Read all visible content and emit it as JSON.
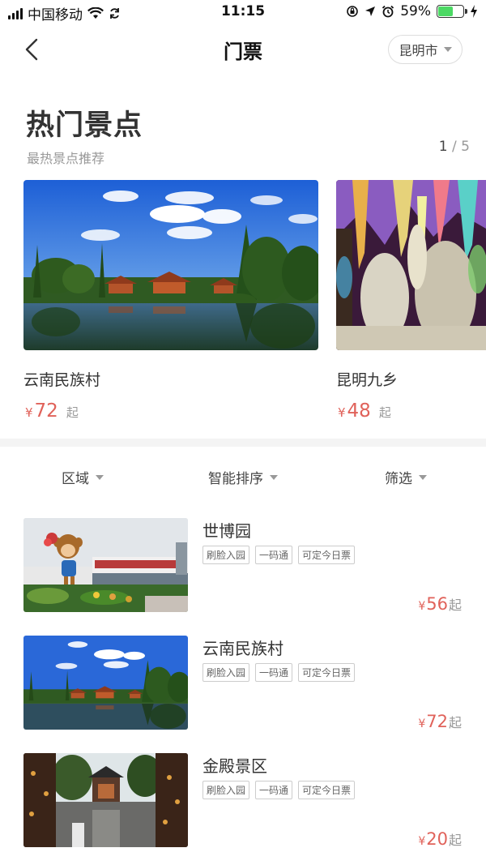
{
  "status_bar": {
    "carrier": "中国移动",
    "time": "11:15",
    "battery": "59%",
    "battery_level": 0.59,
    "battery_color": "#4cd964"
  },
  "nav": {
    "back_icon": "chevron-left-icon",
    "title": "门票",
    "city": "昆明市"
  },
  "hot": {
    "title": "热门景点",
    "subtitle": "最热景点推荐",
    "pager_current": "1",
    "pager_sep": "/",
    "pager_total": "5",
    "items": [
      {
        "name": "云南民族村",
        "currency": "¥",
        "price": "72",
        "suffix": "起"
      },
      {
        "name": "昆明九乡",
        "currency": "¥",
        "price": "48",
        "suffix": "起"
      }
    ]
  },
  "filters": {
    "area": "区域",
    "sort": "智能排序",
    "filter": "筛选"
  },
  "tickets": [
    {
      "name": "世博园",
      "tags": [
        "刷脸入园",
        "一码通",
        "可定今日票"
      ],
      "currency": "¥",
      "price": "56",
      "suffix": "起"
    },
    {
      "name": "云南民族村",
      "tags": [
        "刷脸入园",
        "一码通",
        "可定今日票"
      ],
      "currency": "¥",
      "price": "72",
      "suffix": "起"
    },
    {
      "name": "金殿景区",
      "tags": [
        "刷脸入园",
        "一码通",
        "可定今日票"
      ],
      "currency": "¥",
      "price": "20",
      "suffix": "起"
    }
  ],
  "colors": {
    "price": "#e0625a",
    "muted": "#999999",
    "divider": "#f4f4f4"
  }
}
